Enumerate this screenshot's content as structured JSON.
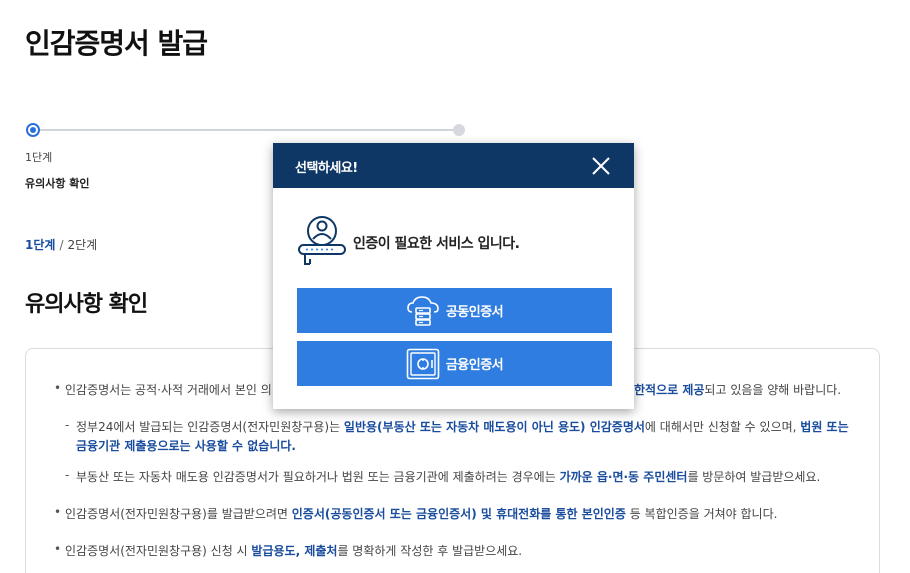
{
  "page": {
    "title": "인감증명서 발급"
  },
  "stepper": {
    "current_step_number": "1단계",
    "current_step_name": "유의사항 확인"
  },
  "breadcrumb": {
    "current": "1단계",
    "separator": "/",
    "total": "2단계"
  },
  "section": {
    "title": "유의사항 확인"
  },
  "notices": {
    "n1_pre": "인감증명서는 공적·사적 거래에서 본인 의",
    "n1_hl": "한적으로 제공",
    "n1_post": "되고 있음을 양해 바랍니다.",
    "n2_pre": "정부24에서 발급되는 인감증명서(전자민원창구용)는 ",
    "n2_hl": "일반용(부동산 또는 자동차 매도용이 아닌 용도) 인감증명서",
    "n2_mid": "에 대해서만 신청할 수 있으며, ",
    "n2_hl2": "법원 또는",
    "n2_line2_hl": "금융기관 제출용으로는 사용할 수 없습니다.",
    "n3_pre": "부동산 또는 자동차 매도용 인감증명서가 필요하거나 법원 또는 금융기관에 제출하려는 경우에는 ",
    "n3_hl": "가까운 읍·면·동 주민센터",
    "n3_post": "를 방문하여 발급받으세요.",
    "n4_pre": "인감증명서(전자민원창구용)를 발급받으려면 ",
    "n4_hl": "인증서(공동인증서 또는 금융인증서) 및 휴대전화를 통한 본인인증",
    "n4_post": " 등 복합인증을 거쳐야 합니다.",
    "n5_pre": "인감증명서(전자민원창구용) 신청 시 ",
    "n5_hl": "발급용도, 제출처",
    "n5_post": "를 명확하게 작성한 후 발급받으세요."
  },
  "modal": {
    "title": "선택하세요!",
    "message": "인증이 필요한 서비스 입니다.",
    "buttons": {
      "joint_cert": "공동인증서",
      "financial_cert": "금융인증서"
    }
  },
  "colors": {
    "modal_header": "#0f3766",
    "button": "#2f7de1",
    "highlight": "#1a4c9e",
    "step_active": "#2b6fdd"
  },
  "icons": {
    "close": "close-icon",
    "auth": "user-auth-icon",
    "joint_cert": "cloud-server-icon",
    "financial_cert": "safe-icon"
  }
}
